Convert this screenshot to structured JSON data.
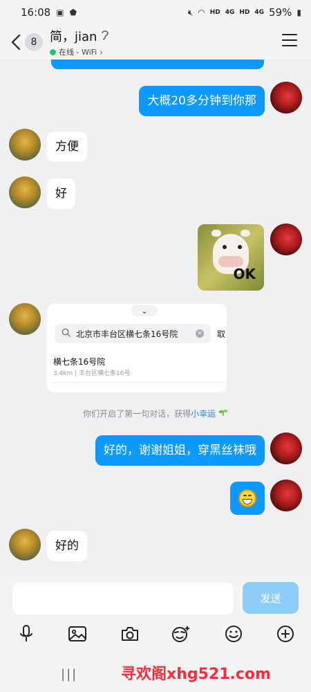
{
  "status_bar": {
    "time": "16:08",
    "hd1": "HD",
    "net1": "4G",
    "hd2": "HD",
    "net2": "4G",
    "battery": "59%"
  },
  "header": {
    "back_label": "<",
    "unread_count": "8",
    "contact_name": "简，jian",
    "presence": "在线 - WiFi",
    "presence_arrow": "›",
    "presence_color": "#27c46b"
  },
  "messages": [
    {
      "from": "me",
      "text": "大概20多分钟到你那"
    },
    {
      "from": "other",
      "text": "方便"
    },
    {
      "from": "other",
      "text": "好"
    },
    {
      "from": "me",
      "type": "sticker",
      "sticker_text": "OK"
    },
    {
      "from": "other",
      "type": "location"
    },
    {
      "from": "me",
      "text": "好的，谢谢姐姐，穿黑丝袜哦"
    },
    {
      "from": "me",
      "type": "emoji",
      "emoji": "grinning-face"
    },
    {
      "from": "other",
      "text": "好的"
    }
  ],
  "location_card": {
    "handle": "⌄",
    "search_value": "北京市丰台区横七条16号院",
    "cancel_label": "取",
    "result_title": "横七条16号院",
    "result_sub": "3.4km | 丰台区横七条16号"
  },
  "system_message": {
    "text": "你们开启了第一句对话，获得",
    "link": "小幸运"
  },
  "input": {
    "value": "",
    "send_label": "发送"
  },
  "toolbar": {
    "icons": [
      "microphone-icon",
      "image-icon",
      "camera-icon",
      "sticker-icon",
      "emoji-icon",
      "plus-icon"
    ]
  },
  "nav": {
    "recents_label": "|||",
    "watermark": "寻欢阁xhg521.com"
  },
  "colors": {
    "my_bubble": "#0d99ff",
    "send_button": "#8ccdf9",
    "link": "#2d7ff0",
    "watermark": "#ff2a3a"
  }
}
